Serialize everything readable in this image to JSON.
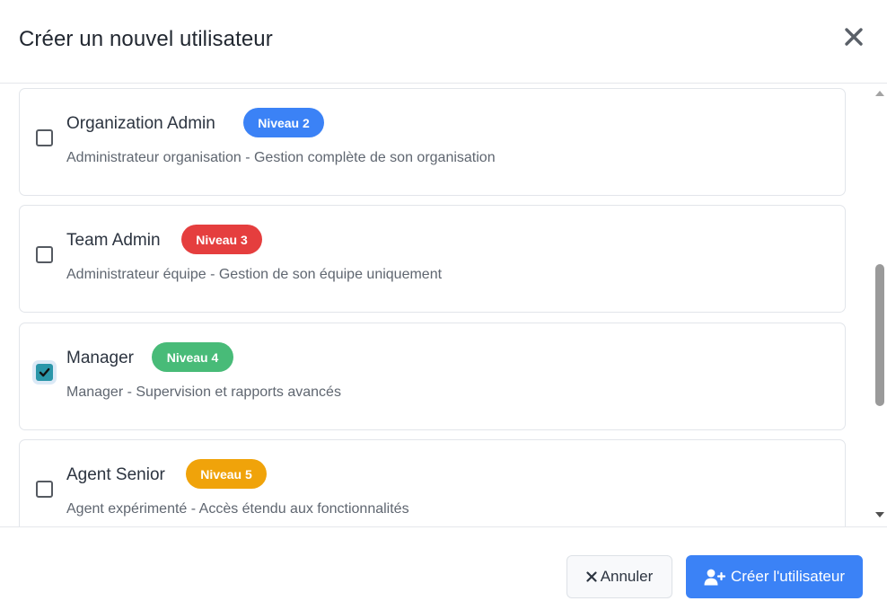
{
  "header": {
    "title": "Créer un nouvel utilisateur"
  },
  "roles": [
    {
      "name": "Organization Admin",
      "badge": "Niveau 2",
      "badge_color": "#3b82f6",
      "description": "Administrateur organisation - Gestion complète de son organisation",
      "checked": false
    },
    {
      "name": "Team Admin",
      "badge": "Niveau 3",
      "badge_color": "#e53e3e",
      "description": "Administrateur équipe - Gestion de son équipe uniquement",
      "checked": false
    },
    {
      "name": "Manager",
      "badge": "Niveau 4",
      "badge_color": "#48bb78",
      "description": "Manager - Supervision et rapports avancés",
      "checked": true
    },
    {
      "name": "Agent Senior",
      "badge": "Niveau 5",
      "badge_color": "#f0a30a",
      "description": "Agent expérimenté - Accès étendu aux fonctionnalités",
      "checked": false
    }
  ],
  "footer": {
    "cancel_label": "Annuler",
    "create_label": "Créer l'utilisateur"
  },
  "icons": {
    "close": "close-icon",
    "cancel": "times-icon",
    "create": "user-plus-icon",
    "check": "checkmark-icon"
  }
}
